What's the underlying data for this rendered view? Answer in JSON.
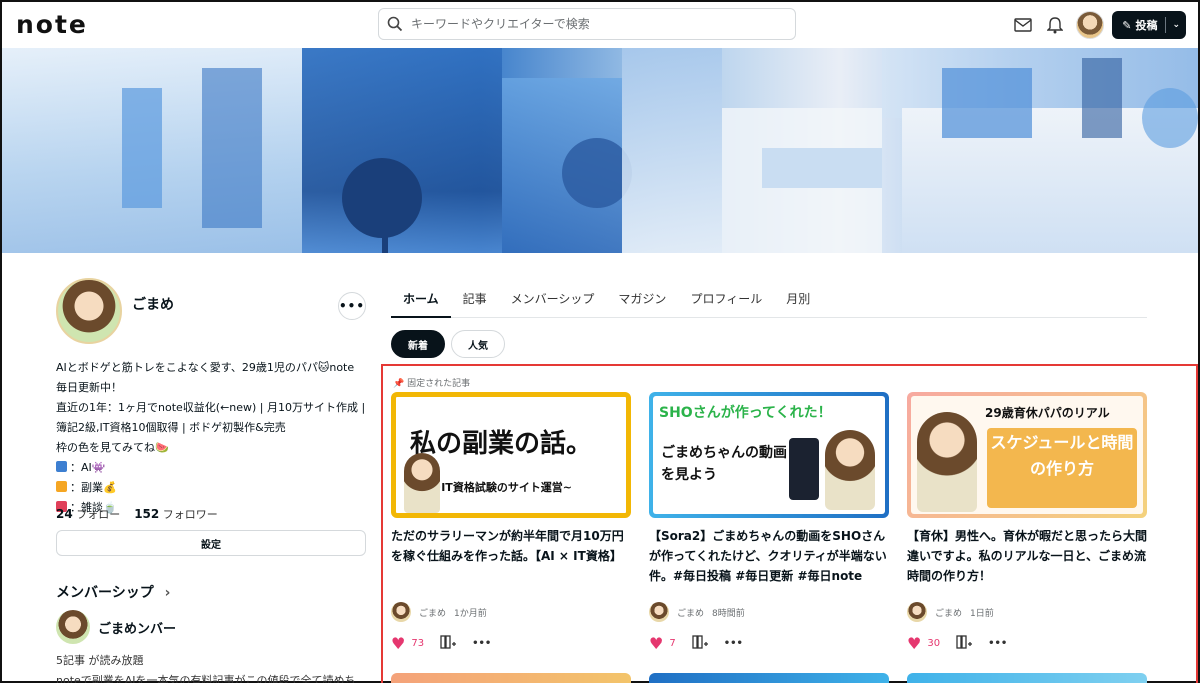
{
  "header": {
    "logo": "note",
    "search_placeholder": "キーワードやクリエイターで検索",
    "post_label": "投稿"
  },
  "profile": {
    "name": "ごまめ",
    "bio_lines": [
      "AIとボドゲと筋トレをこよなく愛す、29歳1児のパパ🐱note",
      "毎日更新中！",
      "直近の1年：1ヶ月でnote収益化(←new) | 月10万サイト作成 |",
      "簿記2級,IT資格10個取得 | ボドゲ初製作&完売",
      "枠の色を見てみてね🍉",
      "：AI👾",
      "：副業💰",
      "：雑談🍵"
    ],
    "follow_count": "24",
    "follow_label": "フォロー",
    "follower_count": "152",
    "follower_label": "フォロワー",
    "settings_label": "設定"
  },
  "membership": {
    "title": "メンバーシップ",
    "chevron": "›",
    "name": "ごまめンバー",
    "count_text": "5記事 が読み放題",
    "desc": "noteで副業をAIを一本気の有料記事がこの値段で全て読めち"
  },
  "tabs": [
    "ホーム",
    "記事",
    "メンバーシップ",
    "マガジン",
    "プロフィール",
    "月別"
  ],
  "filters": [
    "新着",
    "人気"
  ],
  "pinned_label": "固定された記事",
  "articles": [
    {
      "thumb_main": "私の副業の話。",
      "thumb_sub": "~IT資格試験のサイト運営~",
      "title": "ただのサラリーマンが約半年間で月10万円を稼ぐ仕組みを作った話。【AI × IT資格】",
      "author": "ごまめ",
      "time": "1か月前",
      "likes": "73"
    },
    {
      "thumb_main": "SHOさんが作ってくれた！",
      "thumb_sub": "ごまめちゃんの動画を見よう",
      "title": "【Sora2】ごまめちゃんの動画をSHOさんが作ってくれたけど、クオリティが半端ない件。#毎日投稿 #毎日更新 #毎日note",
      "author": "ごまめ",
      "time": "8時間前",
      "likes": "7"
    },
    {
      "thumb_main": "29歳育休パパのリアル",
      "thumb_sub": "スケジュールと時間の作り方",
      "title": "【育休】男性へ。育休が暇だと思ったら大間違いですよ。私のリアルな一日と、ごまめ流時間の作り方！",
      "author": "ごまめ",
      "time": "1日前",
      "likes": "30"
    }
  ],
  "colors": {
    "accent": "#08131a",
    "like": "#e5376f",
    "highlight_border": "#e53935",
    "sq_blue": "#3d7fd1",
    "sq_orange": "#f5a623",
    "sq_red": "#e0405a"
  }
}
